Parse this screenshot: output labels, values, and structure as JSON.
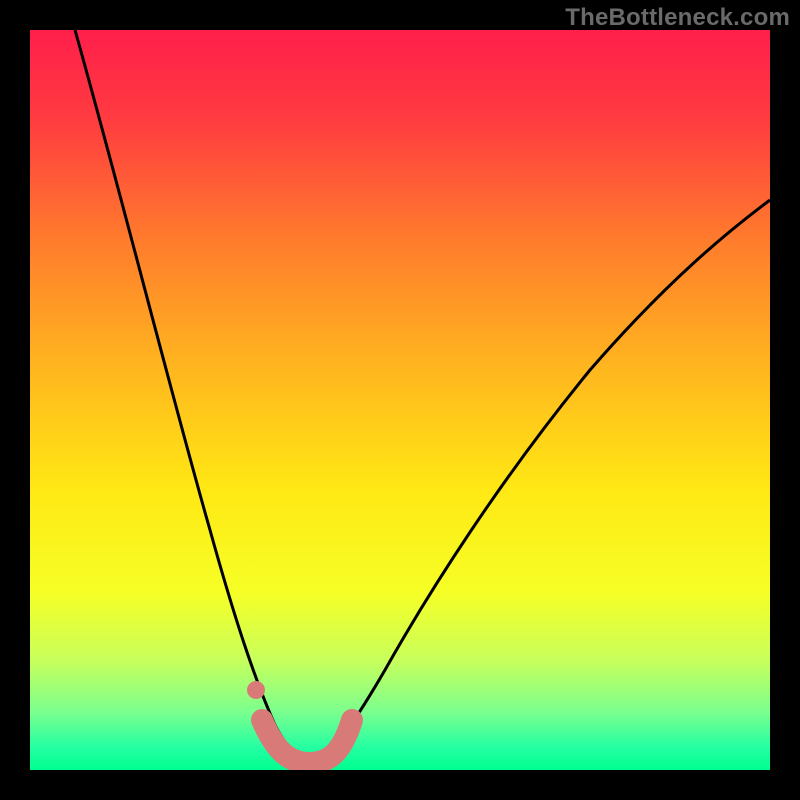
{
  "watermark": "TheBottleneck.com",
  "chart_data": {
    "type": "line",
    "title": "",
    "xlabel": "",
    "ylabel": "",
    "xlim": [
      0,
      100
    ],
    "ylim": [
      0,
      100
    ],
    "background_gradient_stops": [
      {
        "pct": 0,
        "color": "#ff1f4b"
      },
      {
        "pct": 12,
        "color": "#ff3b40"
      },
      {
        "pct": 28,
        "color": "#ff7a2d"
      },
      {
        "pct": 45,
        "color": "#ffb41f"
      },
      {
        "pct": 62,
        "color": "#ffe814"
      },
      {
        "pct": 76,
        "color": "#f6ff26"
      },
      {
        "pct": 85,
        "color": "#c9ff5a"
      },
      {
        "pct": 92,
        "color": "#7dff8d"
      },
      {
        "pct": 97,
        "color": "#23ffa2"
      },
      {
        "pct": 100,
        "color": "#00ff90"
      }
    ],
    "series": [
      {
        "name": "bottleneck-curve-left",
        "color": "#000000",
        "x": [
          6,
          8,
          10,
          12,
          14,
          16,
          18,
          20,
          22,
          24,
          26,
          28,
          30,
          32,
          34,
          36,
          38
        ],
        "y": [
          100,
          92,
          84,
          76,
          68,
          60,
          52,
          44,
          37,
          30,
          23,
          17,
          12,
          8,
          5,
          3,
          2
        ]
      },
      {
        "name": "bottleneck-curve-right",
        "color": "#000000",
        "x": [
          38,
          40,
          44,
          48,
          52,
          56,
          60,
          64,
          68,
          72,
          76,
          80,
          84,
          88,
          92,
          96,
          100
        ],
        "y": [
          2,
          3,
          6,
          10,
          15,
          21,
          27,
          33,
          39,
          45,
          51,
          56,
          61,
          66,
          70,
          74,
          77
        ]
      },
      {
        "name": "optimal-band",
        "color": "#d87b78",
        "x": [
          31,
          33,
          35,
          37,
          39,
          41,
          43
        ],
        "y": [
          7,
          3,
          1.5,
          1.2,
          1.5,
          3,
          7
        ]
      }
    ],
    "markers": [
      {
        "name": "optimal-dot",
        "x": 31,
        "y": 12,
        "color": "#d87b78"
      }
    ]
  }
}
